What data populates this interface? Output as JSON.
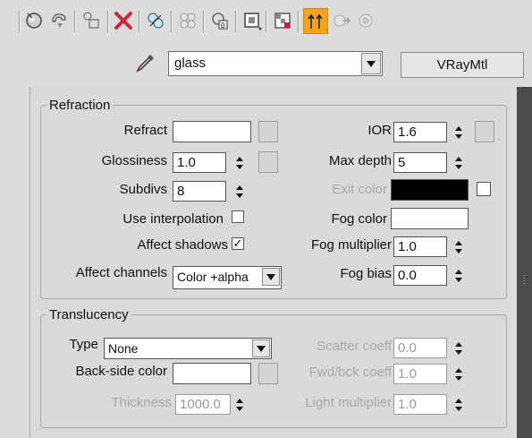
{
  "toolbar": {
    "icons": [
      "get-material-icon",
      "put-to-scene-icon",
      "assign-material-icon",
      "delete-icon",
      "make-unique-icon",
      "put-to-library-icon",
      "material-id-icon",
      "show-in-viewport-icon",
      "show-end-result-icon",
      "go-to-parent-icon",
      "go-forward-sibling-icon",
      "pick-material-icon"
    ]
  },
  "material": {
    "name": "glass",
    "type": "VRayMtl"
  },
  "refraction": {
    "title": "Refraction",
    "refract_label": "Refract",
    "ior_label": "IOR",
    "ior_value": "1.6",
    "glossiness_label": "Glossiness",
    "glossiness_value": "1.0",
    "max_depth_label": "Max depth",
    "max_depth_value": "5",
    "subdivs_label": "Subdivs",
    "subdivs_value": "8",
    "exit_color_label": "Exit color",
    "use_interp_label": "Use interpolation",
    "use_interp_checked": false,
    "fog_color_label": "Fog color",
    "affect_shadows_label": "Affect shadows",
    "affect_shadows_mark": "✓",
    "fog_multiplier_label": "Fog multiplier",
    "fog_multiplier_value": "1.0",
    "affect_channels_label": "Affect channels",
    "affect_channels_value": "Color +alpha",
    "fog_bias_label": "Fog bias",
    "fog_bias_value": "0.0"
  },
  "translucency": {
    "title": "Translucency",
    "type_label": "Type",
    "type_value": "None",
    "scatter_label": "Scatter coeff",
    "scatter_value": "0.0",
    "backside_label": "Back-side color",
    "fwd_bck_label": "Fwd/bck coeff",
    "fwd_bck_value": "1.0",
    "thickness_label": "Thickness",
    "thickness_value": "1000.0",
    "light_mult_label": "Light multiplier",
    "light_mult_value": "1.0"
  },
  "colors": {
    "highlight": "#f2a51a",
    "exit_color": "#000000",
    "scrollbar": "#4b4b4b"
  }
}
